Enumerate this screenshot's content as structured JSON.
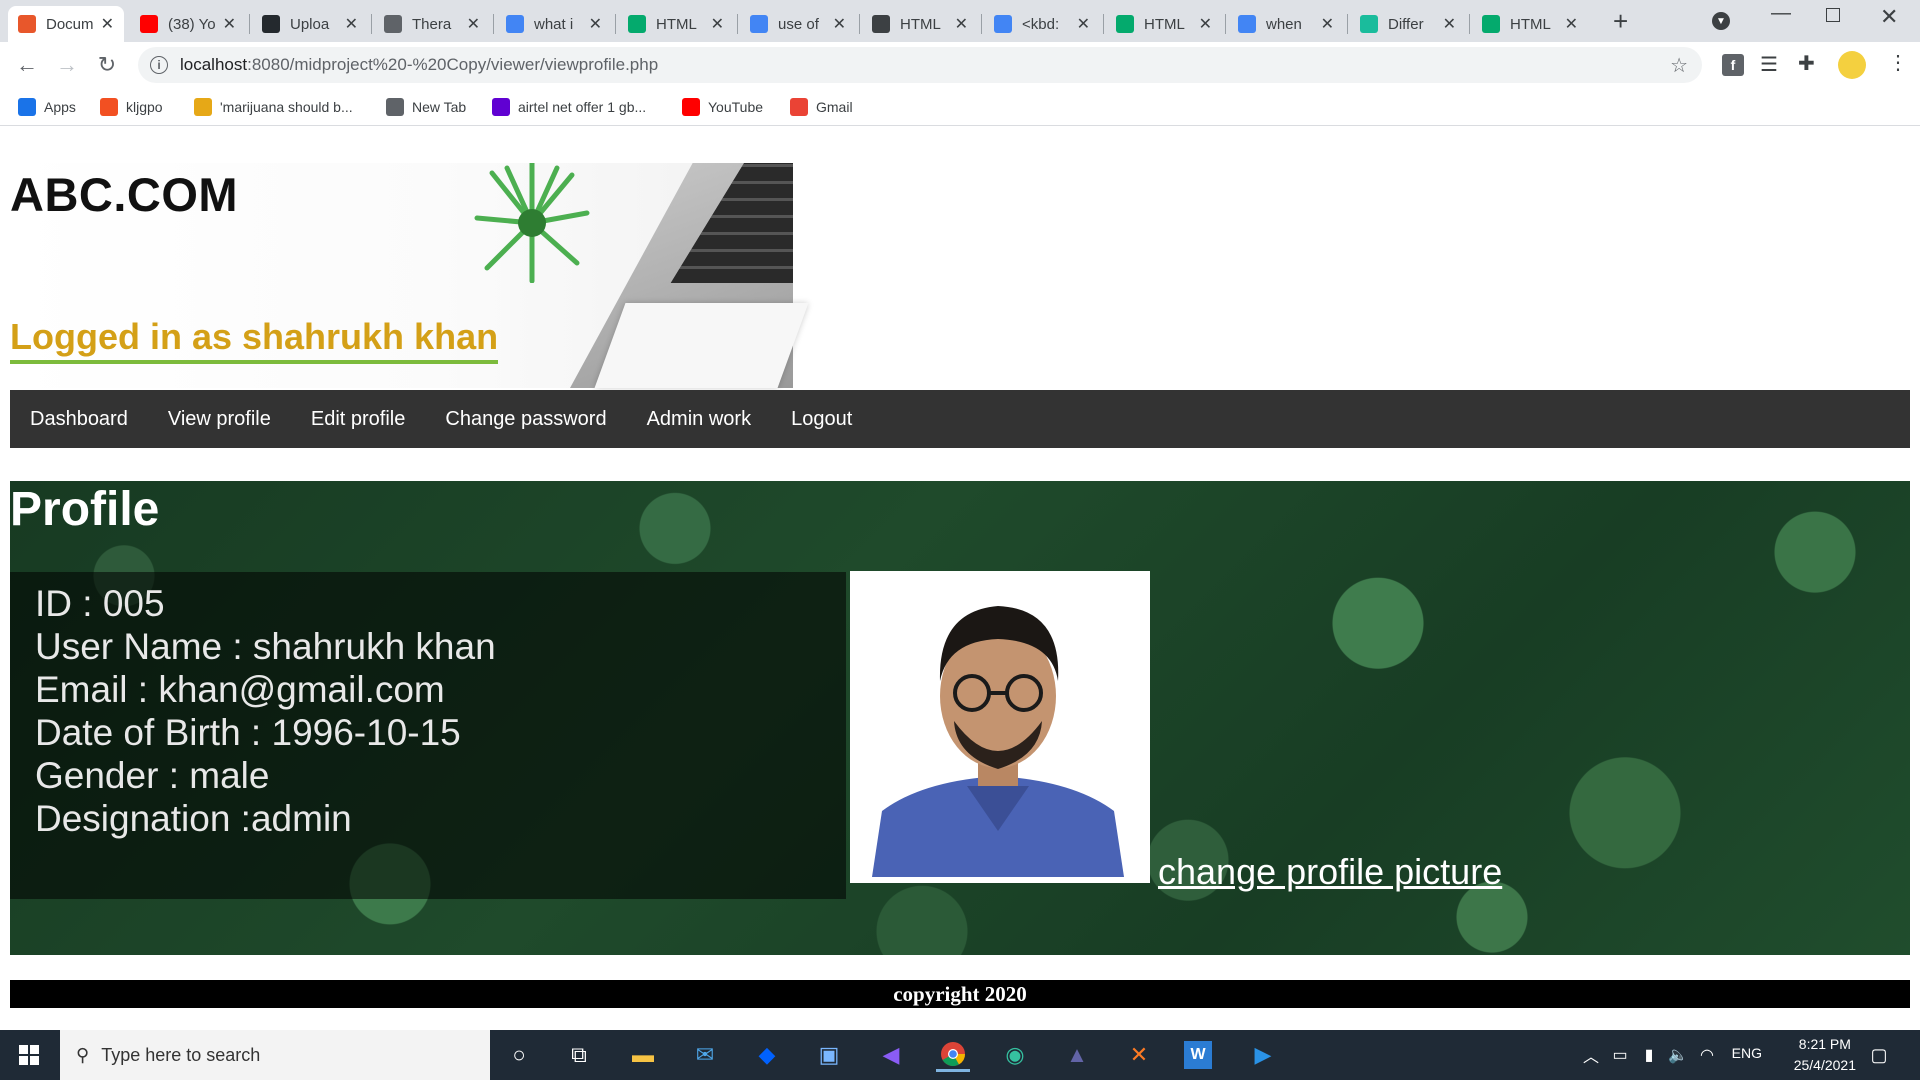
{
  "browser": {
    "tabs": [
      {
        "label": "Docum",
        "icon": "html-file-icon",
        "color": "#e8572b",
        "active": true
      },
      {
        "label": "(38) Yo",
        "icon": "youtube-icon",
        "color": "#ff0000",
        "active": false
      },
      {
        "label": "Uploa",
        "icon": "github-icon",
        "color": "#24292e",
        "active": false
      },
      {
        "label": "Thera",
        "icon": "globe-icon",
        "color": "#5f6368",
        "active": false
      },
      {
        "label": "what i",
        "icon": "google-icon",
        "color": "#4285f4",
        "active": false
      },
      {
        "label": "HTML",
        "icon": "w3schools-icon",
        "color": "#04aa6d",
        "active": false
      },
      {
        "label": "use of",
        "icon": "google-icon",
        "color": "#4285f4",
        "active": false
      },
      {
        "label": "HTML",
        "icon": "diamond-icon",
        "color": "#3c4043",
        "active": false
      },
      {
        "label": "<kbd:",
        "icon": "google-icon",
        "color": "#4285f4",
        "active": false
      },
      {
        "label": "HTML",
        "icon": "w3schools-icon",
        "color": "#04aa6d",
        "active": false
      },
      {
        "label": "when",
        "icon": "google-icon",
        "color": "#4285f4",
        "active": false
      },
      {
        "label": "Differ",
        "icon": "shield-icon",
        "color": "#1abc9c",
        "active": false
      },
      {
        "label": "HTML",
        "icon": "w3schools-icon",
        "color": "#04aa6d",
        "active": false
      }
    ],
    "url_host": "localhost",
    "url_path": ":8080/midproject%20-%20Copy/viewer/viewprofile.php",
    "bookmarks": [
      {
        "label": "Apps",
        "icon": "apps-grid-icon",
        "color": "#1a73e8"
      },
      {
        "label": "kljgpo",
        "icon": "windows-logo-icon",
        "color": "#f25022"
      },
      {
        "label": "'marijuana should b...",
        "icon": "bookmark-icon",
        "color": "#e6a817"
      },
      {
        "label": "New Tab",
        "icon": "globe-icon",
        "color": "#5f6368"
      },
      {
        "label": "airtel net offer 1 gb...",
        "icon": "yahoo-icon",
        "color": "#6001d2"
      },
      {
        "label": "YouTube",
        "icon": "youtube-icon",
        "color": "#ff0000"
      },
      {
        "label": "Gmail",
        "icon": "gmail-icon",
        "color": "#ea4335"
      }
    ]
  },
  "site": {
    "title": "ABC.COM",
    "logged_in": "Logged in as shahrukh khan",
    "nav": [
      "Dashboard",
      "View profile",
      "Edit profile",
      "Change password",
      "Admin work",
      "Logout"
    ],
    "profile_heading": "Profile",
    "profile_lines": [
      "ID : 005",
      "User Name : shahrukh khan",
      "Email : khan@gmail.com",
      "Date of Birth : 1996-10-15",
      "Gender : male",
      "Designation :admin"
    ],
    "change_picture_link": "change profile picture",
    "footer": "copyright 2020"
  },
  "taskbar": {
    "search_placeholder": "Type here to search",
    "language": "ENG",
    "time": "8:21 PM",
    "date": "25/4/2021"
  }
}
